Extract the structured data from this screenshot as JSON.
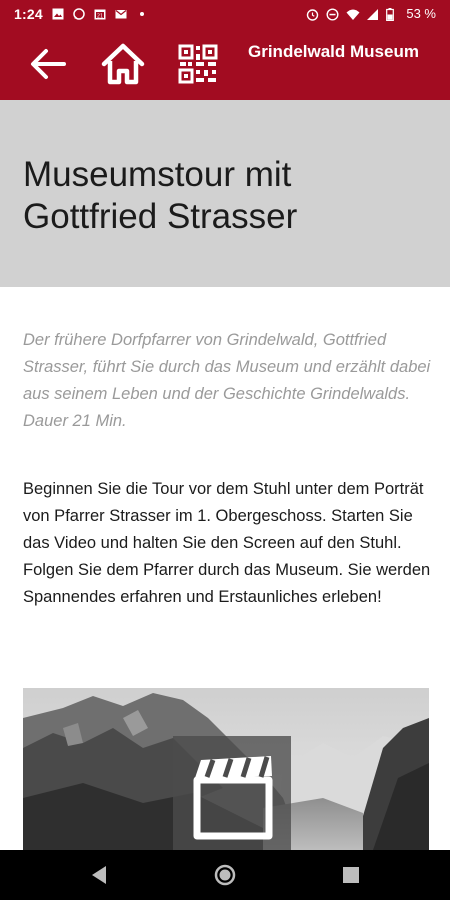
{
  "status_bar": {
    "time": "1:24",
    "battery_percent": "53 %",
    "left_icons": [
      "image-icon",
      "whatsapp-icon",
      "calendar-icon",
      "mail-icon",
      "dot-icon"
    ],
    "right_icons": [
      "alarm-icon",
      "do-not-disturb-icon",
      "wifi-icon",
      "signal-icon",
      "battery-icon"
    ]
  },
  "app_bar": {
    "title": "Grindelwald Museum",
    "back_icon": "back-arrow-icon",
    "home_icon": "home-icon",
    "qr_icon": "qr-code-icon"
  },
  "page": {
    "title": "Museumstour mit Gottfried Strasser",
    "intro": "Der frühere Dorfpfarrer von Grindelwald, Gottfried Strasser, führt Sie durch das Museum und erzählt dabei aus seinem Leben und der Geschichte Grindelwalds. Dauer 21 Min.",
    "instructions": "Beginnen Sie die Tour vor dem Stuhl unter dem Porträt von Pfarrer Strasser im 1. Obergeschoss. Starten Sie das Video und halten Sie den Screen auf den Stuhl. Folgen Sie dem Pfarrer durch das Museum. Sie werden Spannendes erfahren und Erstaunliches erleben!",
    "video_icon": "video-clapper-icon"
  },
  "nav_bar": {
    "icons": [
      "nav-back-icon",
      "nav-home-icon",
      "nav-recents-icon"
    ]
  },
  "colors": {
    "brand": "#a20c21",
    "header_grey": "#d1d1d1",
    "intro_text": "#9a9a9a"
  }
}
